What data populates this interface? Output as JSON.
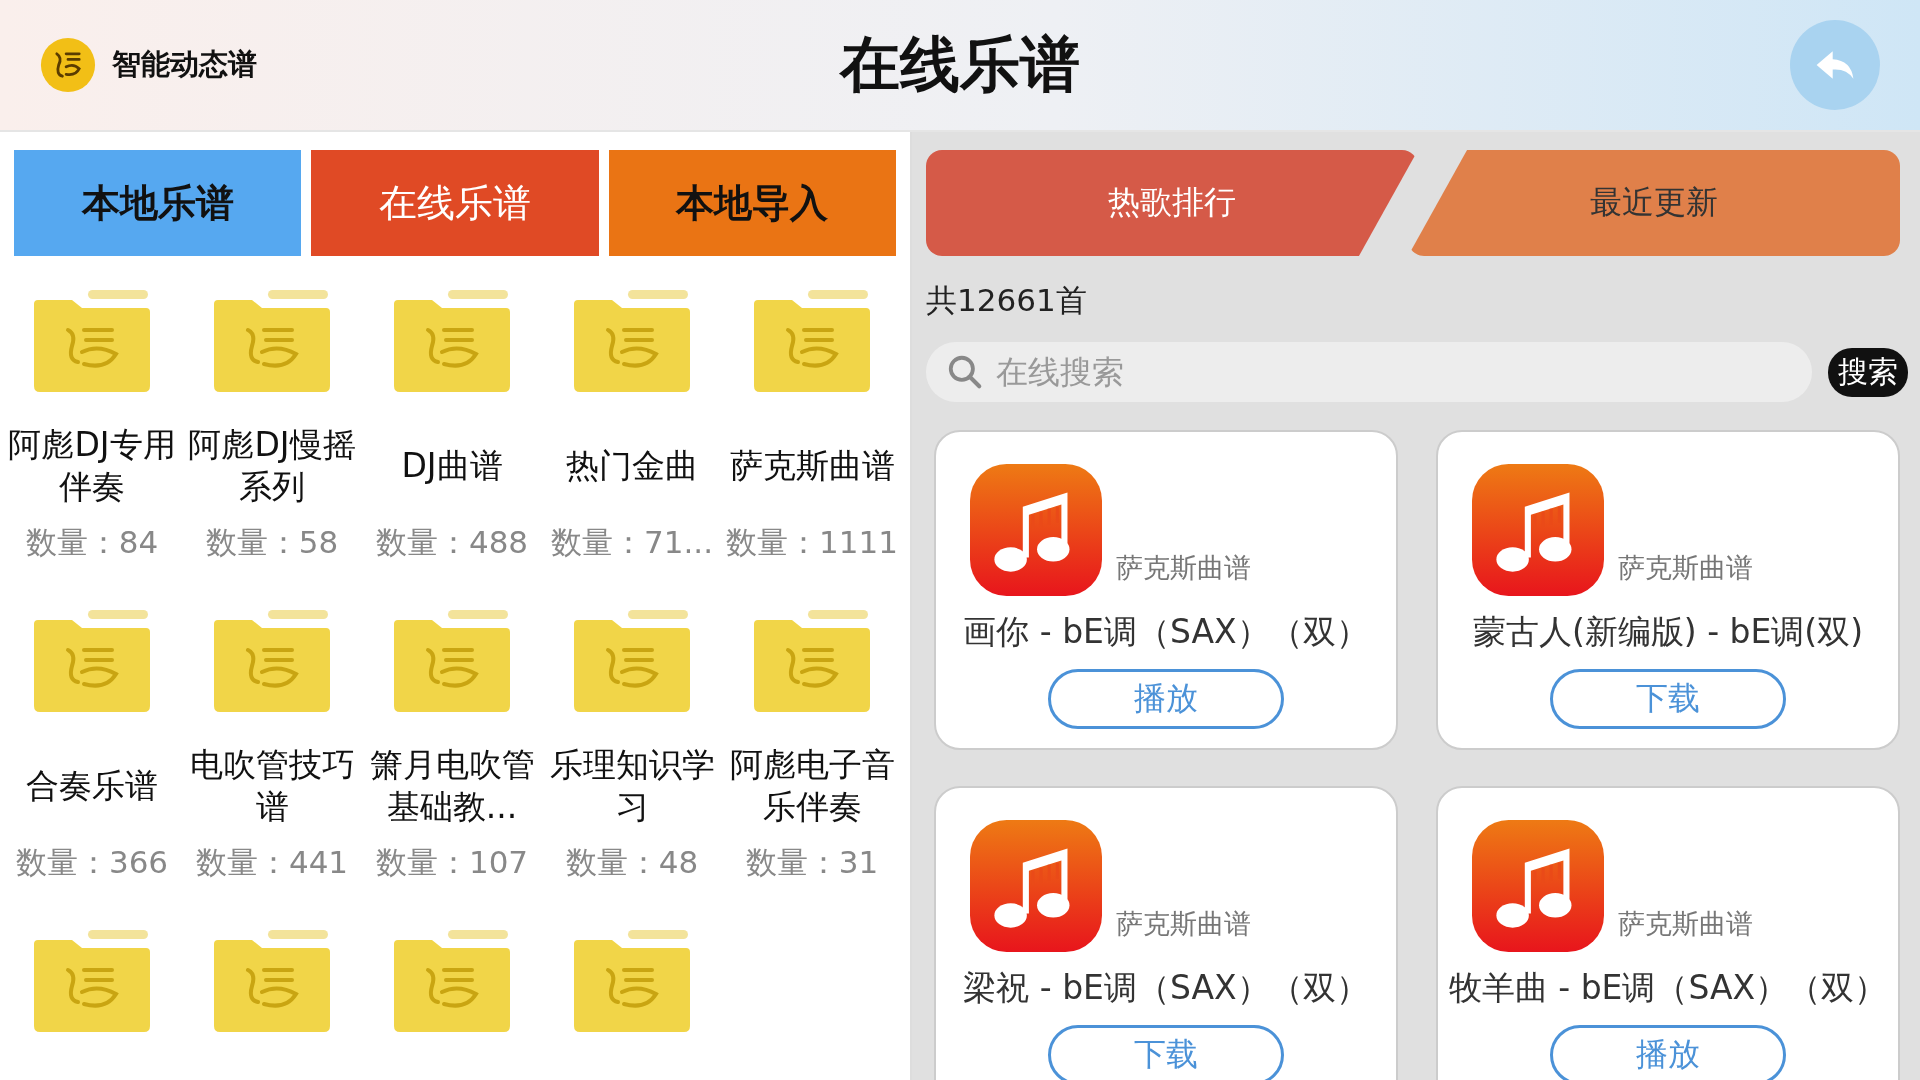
{
  "header": {
    "app_name": "智能动态谱",
    "title": "在线乐谱"
  },
  "left_tabs": [
    {
      "label": "本地乐谱",
      "selected": false,
      "color": "#56a8f0"
    },
    {
      "label": "在线乐谱",
      "selected": true,
      "color": "#e04a25"
    },
    {
      "label": "本地导入",
      "selected": false,
      "color": "#ea7414"
    }
  ],
  "folders": [
    {
      "kind": "labeled",
      "name": "阿彪DJ专用伴奏",
      "count": "数量：84"
    },
    {
      "kind": "labeled",
      "name": "阿彪DJ慢摇系列",
      "count": "数量：58"
    },
    {
      "kind": "labeled",
      "name": "DJ曲谱",
      "count": "数量：488"
    },
    {
      "kind": "labeled",
      "name": "热门金曲",
      "count": "数量：71..."
    },
    {
      "kind": "labeled",
      "name": "萨克斯曲谱",
      "count": "数量：1111"
    },
    {
      "kind": "labeled",
      "name": "合奏乐谱",
      "count": "数量：366"
    },
    {
      "kind": "labeled",
      "name": "电吹管技巧谱",
      "count": "数量：441"
    },
    {
      "kind": "labeled",
      "name": "箫月电吹管基础教...",
      "count": "数量：107"
    },
    {
      "kind": "labeled",
      "name": "乐理知识学习",
      "count": "数量：48"
    },
    {
      "kind": "labeled",
      "name": "阿彪电子音乐伴奏",
      "count": "数量：31"
    },
    {
      "kind": "unlabeled"
    },
    {
      "kind": "unlabeled"
    },
    {
      "kind": "unlabeled"
    },
    {
      "kind": "unlabeled"
    }
  ],
  "right_tabs": [
    {
      "label": "热歌排行",
      "selected": true
    },
    {
      "label": "最近更新",
      "selected": false
    }
  ],
  "total": "共12661首",
  "search": {
    "placeholder": "在线搜索",
    "button": "搜索"
  },
  "songs": [
    {
      "source": "萨克斯曲谱",
      "title": "画你 - bE调（SAX）（双）",
      "action": "播放"
    },
    {
      "source": "萨克斯曲谱",
      "title": "蒙古人(新编版) - bE调(双)",
      "action": "下载"
    },
    {
      "source": "萨克斯曲谱",
      "title": "梁祝 - bE调（SAX）（双）",
      "action": "下载"
    },
    {
      "source": "萨克斯曲谱",
      "title": "牧羊曲 - bE调（SAX）（双）",
      "action": "播放"
    }
  ]
}
